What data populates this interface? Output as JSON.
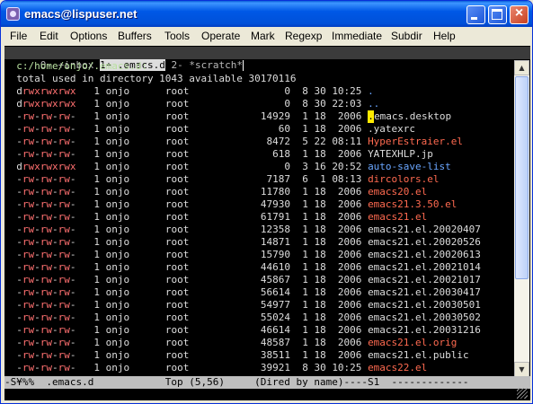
{
  "window": {
    "title": "emacs@lispuser.net",
    "buttons": {
      "minimize": "minimize",
      "maximize": "maximize",
      "close": "close"
    }
  },
  "menubar": {
    "items": [
      "File",
      "Edit",
      "Options",
      "Buffers",
      "Tools",
      "Operate",
      "Mark",
      "Regexp",
      "Immediate",
      "Subdir",
      "Help"
    ]
  },
  "tabline": {
    "tabs": [
      {
        "label": "0- +inbox",
        "active": false
      },
      {
        "label": "1+ .emacs.d",
        "active": true
      },
      {
        "label": "2- *scratch*",
        "active": false
      }
    ]
  },
  "dired": {
    "header": "  c:/home/onjo/.emacs.d:",
    "total": "  total used in directory 1043 available 30170116",
    "rows": [
      {
        "perm": "drwxrwxrwx",
        "links": "1",
        "owner": "onjo",
        "group": "root",
        "size": "0",
        "month": "8",
        "day": "30",
        "time": "10:25",
        "name": ".",
        "ftype": "dir"
      },
      {
        "perm": "drwxrwxrwx",
        "links": "1",
        "owner": "onjo",
        "group": "root",
        "size": "0",
        "month": "8",
        "day": "30",
        "time": "22:03",
        "name": "..",
        "ftype": "dir"
      },
      {
        "perm": "-rw-rw-rw-",
        "links": "1",
        "owner": "onjo",
        "group": "root",
        "size": "14929",
        "month": "1",
        "day": "18",
        "time": "2006",
        "name": ".emacs.desktop",
        "ftype": "cursor"
      },
      {
        "perm": "-rw-rw-rw-",
        "links": "1",
        "owner": "onjo",
        "group": "root",
        "size": "60",
        "month": "1",
        "day": "18",
        "time": "2006",
        "name": ".yatexrc",
        "ftype": "default"
      },
      {
        "perm": "-rw-rw-rw-",
        "links": "1",
        "owner": "onjo",
        "group": "root",
        "size": "8472",
        "month": "5",
        "day": "22",
        "time": "08:11",
        "name": "HyperEstraier.el",
        "ftype": "el"
      },
      {
        "perm": "-rw-rw-rw-",
        "links": "1",
        "owner": "onjo",
        "group": "root",
        "size": "618",
        "month": "1",
        "day": "18",
        "time": "2006",
        "name": "YATEXHLP.jp",
        "ftype": "default"
      },
      {
        "perm": "drwxrwxrwx",
        "links": "1",
        "owner": "onjo",
        "group": "root",
        "size": "0",
        "month": "3",
        "day": "16",
        "time": "20:52",
        "name": "auto-save-list",
        "ftype": "dirname"
      },
      {
        "perm": "-rw-rw-rw-",
        "links": "1",
        "owner": "onjo",
        "group": "root",
        "size": "7187",
        "month": "6",
        "day": "1",
        "time": "08:13",
        "name": "dircolors.el",
        "ftype": "el"
      },
      {
        "perm": "-rw-rw-rw-",
        "links": "1",
        "owner": "onjo",
        "group": "root",
        "size": "11780",
        "month": "1",
        "day": "18",
        "time": "2006",
        "name": "emacs20.el",
        "ftype": "el"
      },
      {
        "perm": "-rw-rw-rw-",
        "links": "1",
        "owner": "onjo",
        "group": "root",
        "size": "47930",
        "month": "1",
        "day": "18",
        "time": "2006",
        "name": "emacs21.3.50.el",
        "ftype": "el"
      },
      {
        "perm": "-rw-rw-rw-",
        "links": "1",
        "owner": "onjo",
        "group": "root",
        "size": "61791",
        "month": "1",
        "day": "18",
        "time": "2006",
        "name": "emacs21.el",
        "ftype": "el"
      },
      {
        "perm": "-rw-rw-rw-",
        "links": "1",
        "owner": "onjo",
        "group": "root",
        "size": "12358",
        "month": "1",
        "day": "18",
        "time": "2006",
        "name": "emacs21.el.20020407",
        "ftype": "default"
      },
      {
        "perm": "-rw-rw-rw-",
        "links": "1",
        "owner": "onjo",
        "group": "root",
        "size": "14871",
        "month": "1",
        "day": "18",
        "time": "2006",
        "name": "emacs21.el.20020526",
        "ftype": "default"
      },
      {
        "perm": "-rw-rw-rw-",
        "links": "1",
        "owner": "onjo",
        "group": "root",
        "size": "15790",
        "month": "1",
        "day": "18",
        "time": "2006",
        "name": "emacs21.el.20020613",
        "ftype": "default"
      },
      {
        "perm": "-rw-rw-rw-",
        "links": "1",
        "owner": "onjo",
        "group": "root",
        "size": "44610",
        "month": "1",
        "day": "18",
        "time": "2006",
        "name": "emacs21.el.20021014",
        "ftype": "default"
      },
      {
        "perm": "-rw-rw-rw-",
        "links": "1",
        "owner": "onjo",
        "group": "root",
        "size": "45867",
        "month": "1",
        "day": "18",
        "time": "2006",
        "name": "emacs21.el.20021017",
        "ftype": "default"
      },
      {
        "perm": "-rw-rw-rw-",
        "links": "1",
        "owner": "onjo",
        "group": "root",
        "size": "56614",
        "month": "1",
        "day": "18",
        "time": "2006",
        "name": "emacs21.el.20030417",
        "ftype": "default"
      },
      {
        "perm": "-rw-rw-rw-",
        "links": "1",
        "owner": "onjo",
        "group": "root",
        "size": "54977",
        "month": "1",
        "day": "18",
        "time": "2006",
        "name": "emacs21.el.20030501",
        "ftype": "default"
      },
      {
        "perm": "-rw-rw-rw-",
        "links": "1",
        "owner": "onjo",
        "group": "root",
        "size": "55024",
        "month": "1",
        "day": "18",
        "time": "2006",
        "name": "emacs21.el.20030502",
        "ftype": "default"
      },
      {
        "perm": "-rw-rw-rw-",
        "links": "1",
        "owner": "onjo",
        "group": "root",
        "size": "46614",
        "month": "1",
        "day": "18",
        "time": "2006",
        "name": "emacs21.el.20031216",
        "ftype": "default"
      },
      {
        "perm": "-rw-rw-rw-",
        "links": "1",
        "owner": "onjo",
        "group": "root",
        "size": "48587",
        "month": "1",
        "day": "18",
        "time": "2006",
        "name": "emacs21.el.orig",
        "ftype": "el"
      },
      {
        "perm": "-rw-rw-rw-",
        "links": "1",
        "owner": "onjo",
        "group": "root",
        "size": "38511",
        "month": "1",
        "day": "18",
        "time": "2006",
        "name": "emacs21.el.public",
        "ftype": "default"
      },
      {
        "perm": "-rw-rw-rw-",
        "links": "1",
        "owner": "onjo",
        "group": "root",
        "size": "39921",
        "month": "8",
        "day": "30",
        "time": "10:25",
        "name": "emacs22.el",
        "ftype": "el"
      }
    ]
  },
  "modeline": {
    "text": "-S¥%%  .emacs.d            Top (5,56)     (Dired by name)----S1  -------------"
  },
  "colors": {
    "background": "#000000",
    "foreground": "#dddddd",
    "el_file": "#ff6a50",
    "dir_name": "#6aa6ff",
    "perm_bits": "#ff7070",
    "header": "#b8e0a0",
    "cursor": "#ffea00"
  }
}
